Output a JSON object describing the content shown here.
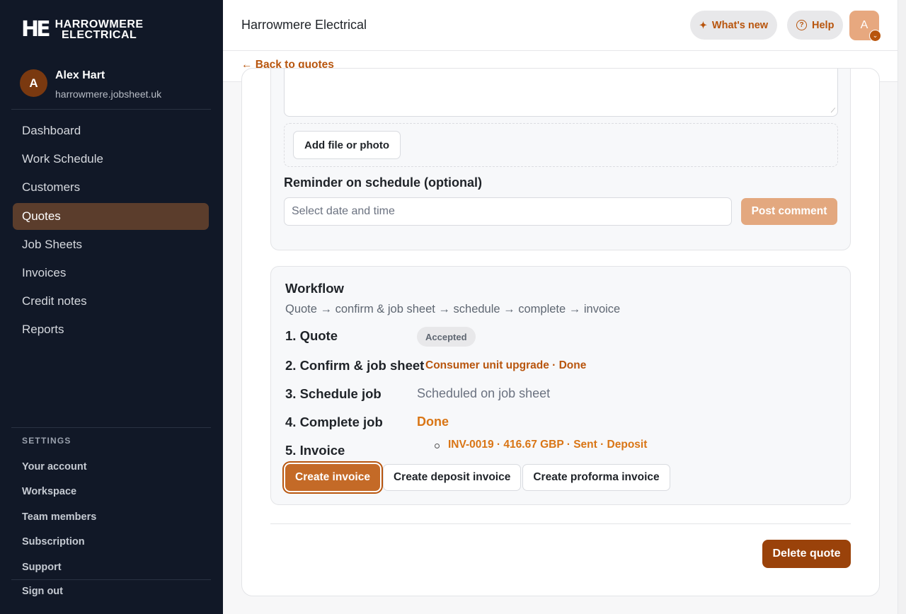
{
  "brand": {
    "mark": "HE",
    "line1": "HARROWMERE",
    "line2": "ELECTRICAL"
  },
  "user": {
    "initial": "A",
    "name": "Alex Hart",
    "domain": "harrowmere.jobsheet.uk"
  },
  "nav": [
    {
      "label": "Dashboard"
    },
    {
      "label": "Work Schedule"
    },
    {
      "label": "Customers"
    },
    {
      "label": "Quotes",
      "active": true
    },
    {
      "label": "Job Sheets"
    },
    {
      "label": "Invoices"
    },
    {
      "label": "Credit notes"
    },
    {
      "label": "Reports"
    }
  ],
  "settings": {
    "heading": "SETTINGS",
    "items": [
      "Your account",
      "Workspace",
      "Team members",
      "Subscription",
      "Support"
    ]
  },
  "sign_out": "Sign out",
  "header": {
    "title": "Harrowmere Electrical",
    "whats_new": "What's new",
    "help": "Help",
    "avatar_initial": "A"
  },
  "back_link": "← Back to quotes",
  "comment": {
    "attach_label": "Add file or photo",
    "reminder_label": "Reminder on schedule (optional)",
    "date_placeholder": "Select date and time",
    "post_label": "Post comment"
  },
  "workflow": {
    "title": "Workflow",
    "subtitle": "Quote → confirm & job sheet → schedule → complete → invoice",
    "steps": [
      {
        "label": "1. Quote",
        "value": "Accepted"
      },
      {
        "label": "2. Confirm & job sheet",
        "value": "Consumer unit upgrade · Done"
      },
      {
        "label": "3. Schedule job",
        "value": "Scheduled on job sheet"
      },
      {
        "label": "4. Complete job",
        "value": "Done"
      },
      {
        "label": "5. Invoice",
        "value": "INV-0019 · 416.67 GBP · Sent · Deposit"
      }
    ],
    "buttons": {
      "create_invoice": "Create invoice",
      "create_deposit": "Create deposit invoice",
      "create_proforma": "Create proforma invoice"
    }
  },
  "delete_label": "Delete quote",
  "colors": {
    "accent": "#b8550d",
    "sidebar": "#111827",
    "danger": "#9a420a"
  }
}
